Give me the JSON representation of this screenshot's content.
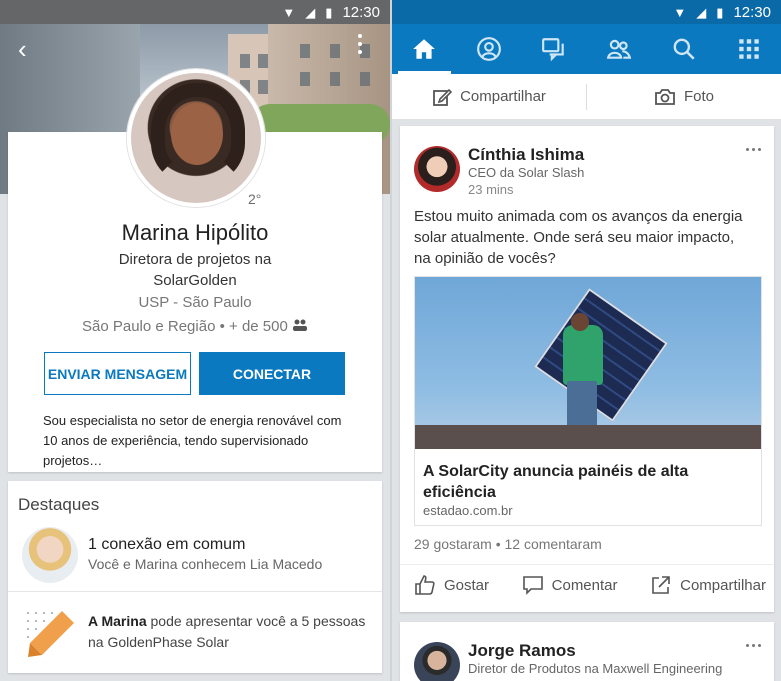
{
  "status_bar": {
    "time": "12:30"
  },
  "profile": {
    "degree": "2°",
    "name": "Marina Hipólito",
    "title": "Diretora de projetos na SolarGolden",
    "school": "USP - São Paulo",
    "location": "São Paulo e Região",
    "connections": "+ de 500",
    "message_button": "ENVIAR MENSAGEM",
    "connect_button": "CONECTAR",
    "summary": "Sou especialista no setor de energia renovável com 10 anos de experiência, tendo supervisionado projetos…"
  },
  "highlights": {
    "title": "Destaques",
    "mutual_title": "1 conexão em comum",
    "mutual_subtitle": "Você e Marina conhecem Lia Macedo",
    "intro_name": "A Marina",
    "intro_text": "pode apresentar você a 5 pessoas na GoldenPhase Solar"
  },
  "nav": {
    "items": [
      "home-icon",
      "profile-icon",
      "messages-icon",
      "network-icon",
      "search-icon",
      "apps-icon"
    ],
    "active": "home-icon"
  },
  "share_bar": {
    "share_label": "Compartilhar",
    "photo_label": "Foto"
  },
  "post1": {
    "author": "Cínthia Ishima",
    "role": "CEO da Solar Slash",
    "time": "23 mins",
    "text": "Estou muito animada com os avanços da energia solar atualmente. Onde será seu maior impacto, na opinião de vocês?",
    "link_title": "A SolarCity anuncia painéis de alta eficiência",
    "link_domain": "estadao.com.br",
    "likes": "29 gostaram",
    "comments": "12 comentaram",
    "like_label": "Gostar",
    "comment_label": "Comentar",
    "share_label": "Compartilhar"
  },
  "post2": {
    "author": "Jorge Ramos",
    "role": "Diretor de Produtos na Maxwell Engineering"
  },
  "colors": {
    "brand_blue": "#0b79bf",
    "background": "#dfe3e6"
  }
}
